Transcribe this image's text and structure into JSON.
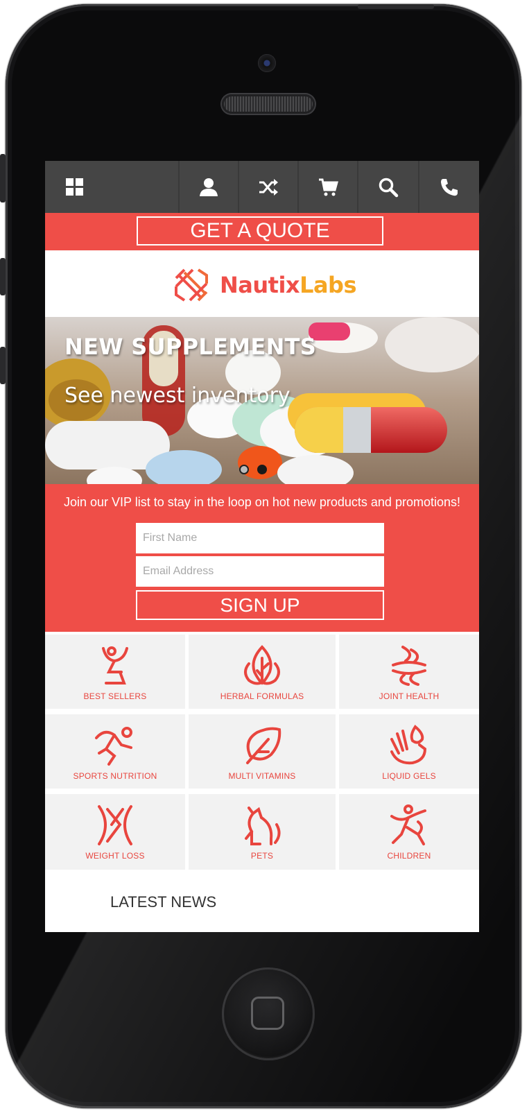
{
  "nav": {
    "icons": [
      "grid-icon",
      "user-icon",
      "shuffle-icon",
      "cart-icon",
      "search-icon",
      "phone-icon"
    ]
  },
  "quote": {
    "label": "GET A QUOTE"
  },
  "brand": {
    "part1": "Nautix",
    "part2": "Labs",
    "primary_color": "#ef4e48",
    "secondary_color": "#f5a623"
  },
  "hero": {
    "title": "NEW SUPPLEMENTS",
    "subtitle": "See newest inventory",
    "slides": 2,
    "active_slide": 2
  },
  "signup": {
    "message": "Join our VIP list to stay in the loop on hot new products and promotions!",
    "first_name_placeholder": "First Name",
    "email_placeholder": "Email Address",
    "button_label": "SIGN UP"
  },
  "categories": [
    {
      "label": "BEST SELLERS",
      "icon": "trophy-person-icon"
    },
    {
      "label": "HERBAL FORMULAS",
      "icon": "leaf-icon"
    },
    {
      "label": "JOINT HEALTH",
      "icon": "joint-icon"
    },
    {
      "label": "SPORTS NUTRITION",
      "icon": "runner-icon"
    },
    {
      "label": "MULTI VITAMINS",
      "icon": "leaf-capsule-icon"
    },
    {
      "label": "LIQUID GELS",
      "icon": "hand-drop-icon"
    },
    {
      "label": "WEIGHT LOSS",
      "icon": "waist-icon"
    },
    {
      "label": "PETS",
      "icon": "cat-icon"
    },
    {
      "label": "CHILDREN",
      "icon": "child-icon"
    }
  ],
  "news": {
    "title": "LATEST NEWS"
  },
  "colors": {
    "accent": "#ef4e48",
    "navbar": "#454545",
    "tile": "#f2f2f2"
  }
}
